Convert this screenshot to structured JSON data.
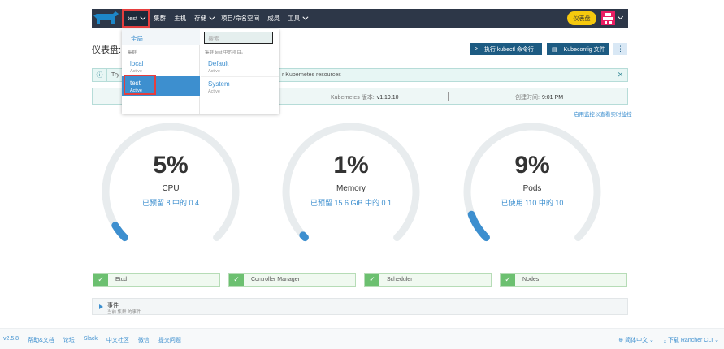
{
  "header": {
    "cluster_label": "test",
    "nav": [
      "集群",
      "主机",
      "存储",
      "项目/命名空间",
      "成员",
      "工具"
    ],
    "dashboard_btn": "仪表盘"
  },
  "title": "仪表盘: t",
  "buttons": {
    "kubectl": "执行 kubectl 命令行",
    "kubeconfig": "Kubeconfig 文件",
    "more": "⋮"
  },
  "banner": {
    "text": "Try",
    "text2": "r Kubernetes resources"
  },
  "info": {
    "k8s_label": "Kubernetes 版本:",
    "k8s_value": "v1.19.10",
    "created_label": "创建时间:",
    "created_value": "9:01 PM"
  },
  "grafana_link": "启用监控以查看实时监控",
  "dropdown": {
    "global": "全局",
    "search_placeholder": "搜索",
    "left_head": "集群",
    "right_head": "集群 test 中的项目。",
    "clusters": [
      {
        "name": "local",
        "state": "Active"
      },
      {
        "name": "test",
        "state": "Active"
      }
    ],
    "projects": [
      {
        "name": "Default",
        "state": "Active"
      },
      {
        "name": "System",
        "state": "Active"
      }
    ]
  },
  "gauges": [
    {
      "pct_text": "5%",
      "pct": 5,
      "label": "CPU",
      "sub": "已预留 8 中的 0.4"
    },
    {
      "pct_text": "1%",
      "pct": 1,
      "label": "Memory",
      "sub": "已预留 15.6 GiB 中的 0.1"
    },
    {
      "pct_text": "9%",
      "pct": 9,
      "label": "Pods",
      "sub": "已使用 110 中的 10"
    }
  ],
  "status": [
    "Etcd",
    "Controller Manager",
    "Scheduler",
    "Nodes"
  ],
  "events": {
    "title": "事件",
    "desc": "当前 集群 的事件"
  },
  "footer": {
    "left": [
      "v2.5.8",
      "帮助&文档",
      "论坛",
      "Slack",
      "中文社区",
      "微信",
      "提交问题"
    ],
    "lang": "简体中文",
    "download": "下载 Rancher CLI"
  },
  "colors": {
    "accent": "#3d8fcf",
    "header": "#2d3748",
    "highlight": "#e53e3e",
    "ok": "#6cc070"
  }
}
